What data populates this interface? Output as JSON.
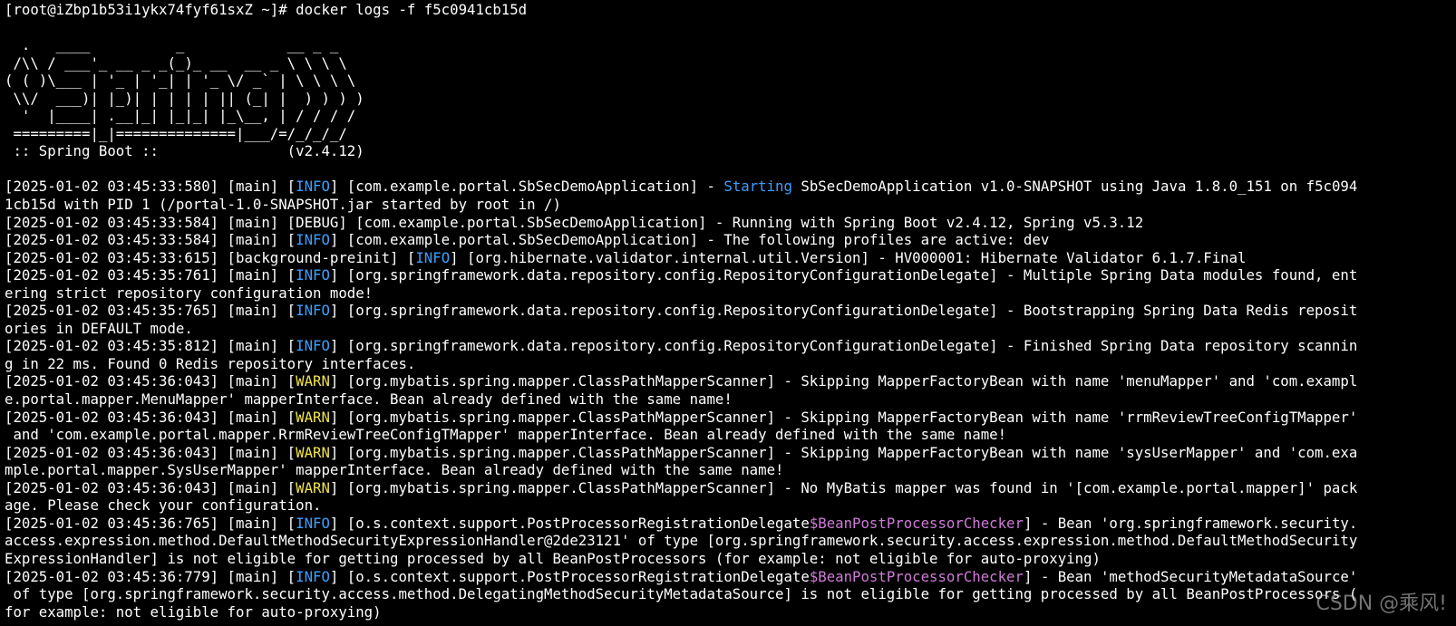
{
  "prompt": "[root@iZbp1b53i1ykx74fyf61sxZ ~]# docker logs -f f5c0941cb15d",
  "banner": [
    "",
    "  .   ____          _            __ _ _",
    " /\\\\ / ___'_ __ _ _(_)_ __  __ _ \\ \\ \\ \\",
    "( ( )\\___ | '_ | '_| | '_ \\/ _` | \\ \\ \\ \\",
    " \\\\/  ___)| |_)| | | | | || (_| |  ) ) ) )",
    "  '  |____| .__|_| |_|_| |_\\__, | / / / /",
    " =========|_|==============|___/=/_/_/_/",
    " :: Spring Boot ::               (v2.4.12)",
    ""
  ],
  "logs": [
    {
      "pre": "[2025-01-02 03:45:33:580] [main] [",
      "level": "INFO",
      "post": "] [com.example.portal.SbSecDemoApplication] - ",
      "hl": "Starting",
      "rest": " SbSecDemoApplication v1.0-SNAPSHOT using Java 1.8.0_151 on f5c094"
    },
    {
      "pre": "1cb15d with PID 1 (/portal-1.0-SNAPSHOT.jar started by root in /)",
      "level": "",
      "post": "",
      "hl": "",
      "rest": ""
    },
    {
      "pre": "[2025-01-02 03:45:33:584] [main] [DEBUG] [com.example.portal.SbSecDemoApplication] - Running with Spring Boot v2.4.12, Spring v5.3.12",
      "level": "",
      "post": "",
      "hl": "",
      "rest": ""
    },
    {
      "pre": "[2025-01-02 03:45:33:584] [main] [",
      "level": "INFO",
      "post": "] [com.example.portal.SbSecDemoApplication] - The following profiles are active: dev",
      "hl": "",
      "rest": ""
    },
    {
      "pre": "[2025-01-02 03:45:33:615] [background-preinit] [",
      "level": "INFO",
      "post": "] [org.hibernate.validator.internal.util.Version] - HV000001: Hibernate Validator 6.1.7.Final",
      "hl": "",
      "rest": ""
    },
    {
      "pre": "[2025-01-02 03:45:35:761] [main] [",
      "level": "INFO",
      "post": "] [org.springframework.data.repository.config.RepositoryConfigurationDelegate] - Multiple Spring Data modules found, ent",
      "hl": "",
      "rest": ""
    },
    {
      "pre": "ering strict repository configuration mode!",
      "level": "",
      "post": "",
      "hl": "",
      "rest": ""
    },
    {
      "pre": "[2025-01-02 03:45:35:765] [main] [",
      "level": "INFO",
      "post": "] [org.springframework.data.repository.config.RepositoryConfigurationDelegate] - Bootstrapping Spring Data Redis reposit",
      "hl": "",
      "rest": ""
    },
    {
      "pre": "ories in DEFAULT mode.",
      "level": "",
      "post": "",
      "hl": "",
      "rest": ""
    },
    {
      "pre": "[2025-01-02 03:45:35:812] [main] [",
      "level": "INFO",
      "post": "] [org.springframework.data.repository.config.RepositoryConfigurationDelegate] - Finished Spring Data repository scannin",
      "hl": "",
      "rest": ""
    },
    {
      "pre": "g in 22 ms. Found 0 Redis repository interfaces.",
      "level": "",
      "post": "",
      "hl": "",
      "rest": ""
    },
    {
      "pre": "[2025-01-02 03:45:36:043] [main] [",
      "level": "WARN",
      "post": "] [org.mybatis.spring.mapper.ClassPathMapperScanner] - Skipping MapperFactoryBean with name 'menuMapper' and 'com.exampl",
      "hl": "",
      "rest": ""
    },
    {
      "pre": "e.portal.mapper.MenuMapper' mapperInterface. Bean already defined with the same name!",
      "level": "",
      "post": "",
      "hl": "",
      "rest": ""
    },
    {
      "pre": "[2025-01-02 03:45:36:043] [main] [",
      "level": "WARN",
      "post": "] [org.mybatis.spring.mapper.ClassPathMapperScanner] - Skipping MapperFactoryBean with name 'rrmReviewTreeConfigTMapper'",
      "hl": "",
      "rest": ""
    },
    {
      "pre": " and 'com.example.portal.mapper.RrmReviewTreeConfigTMapper' mapperInterface. Bean already defined with the same name!",
      "level": "",
      "post": "",
      "hl": "",
      "rest": ""
    },
    {
      "pre": "[2025-01-02 03:45:36:043] [main] [",
      "level": "WARN",
      "post": "] [org.mybatis.spring.mapper.ClassPathMapperScanner] - Skipping MapperFactoryBean with name 'sysUserMapper' and 'com.exa",
      "hl": "",
      "rest": ""
    },
    {
      "pre": "mple.portal.mapper.SysUserMapper' mapperInterface. Bean already defined with the same name!",
      "level": "",
      "post": "",
      "hl": "",
      "rest": ""
    },
    {
      "pre": "[2025-01-02 03:45:36:043] [main] [",
      "level": "WARN",
      "post": "] [org.mybatis.spring.mapper.ClassPathMapperScanner] - No MyBatis mapper was found in '[com.example.portal.mapper]' pack",
      "hl": "",
      "rest": ""
    },
    {
      "pre": "age. Please check your configuration.",
      "level": "",
      "post": "",
      "hl": "",
      "rest": ""
    },
    {
      "pre": "[2025-01-02 03:45:36:765] [main] [",
      "level": "INFO",
      "post": "] [o.s.context.support.PostProcessorRegistrationDelegate",
      "hl2": "$BeanPostProcessorChecker",
      "rest": "] - Bean 'org.springframework.security."
    },
    {
      "pre": "access.expression.method.DefaultMethodSecurityExpressionHandler@2de23121' of type [org.springframework.security.access.expression.method.DefaultMethodSecurity",
      "level": "",
      "post": "",
      "hl": "",
      "rest": ""
    },
    {
      "pre": "ExpressionHandler] is not eligible for getting processed by all BeanPostProcessors (for example: not eligible for auto-proxying)",
      "level": "",
      "post": "",
      "hl": "",
      "rest": ""
    },
    {
      "pre": "[2025-01-02 03:45:36:779] [main] [",
      "level": "INFO",
      "post": "] [o.s.context.support.PostProcessorRegistrationDelegate",
      "hl2": "$BeanPostProcessorChecker",
      "rest": "] - Bean 'methodSecurityMetadataSource'"
    },
    {
      "pre": " of type [org.springframework.security.access.method.DelegatingMethodSecurityMetadataSource] is not eligible for getting processed by all BeanPostProcessors (",
      "level": "",
      "post": "",
      "hl": "",
      "rest": ""
    },
    {
      "pre": "for example: not eligible for auto-proxying)",
      "level": "",
      "post": "",
      "hl": "",
      "rest": ""
    }
  ],
  "watermark": "CSDN @乘风!",
  "colors": {
    "info": "#3aa0ff",
    "warn": "#f0e44a",
    "checker": "#d07bd8",
    "background": "#000000",
    "text": "#ffffff"
  }
}
